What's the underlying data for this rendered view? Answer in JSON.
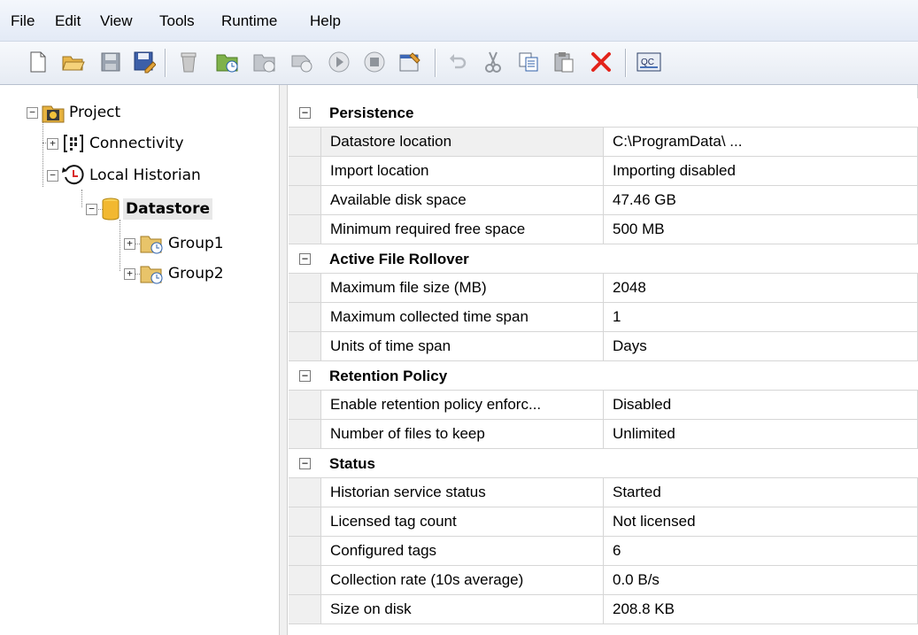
{
  "menu": [
    "File",
    "Edit",
    "View",
    "Tools",
    "Runtime",
    "Help"
  ],
  "toolbar": [
    {
      "name": "new-icon"
    },
    {
      "name": "open-folder-icon"
    },
    {
      "name": "save-icon"
    },
    {
      "name": "save-all-icon"
    },
    {
      "name": "delete-item-icon"
    },
    {
      "name": "add-group-icon"
    },
    {
      "name": "group-icon"
    },
    {
      "name": "tag-icon"
    },
    {
      "name": "start-icon"
    },
    {
      "name": "stop-icon"
    },
    {
      "name": "properties-icon"
    },
    {
      "name": "undo-icon"
    },
    {
      "name": "cut-icon"
    },
    {
      "name": "copy-icon"
    },
    {
      "name": "paste-icon"
    },
    {
      "name": "delete-icon"
    },
    {
      "name": "quick-client-icon",
      "text": "QC"
    }
  ],
  "tree": {
    "project": "Project",
    "connectivity": "Connectivity",
    "local_historian": "Local Historian",
    "datastore": "Datastore",
    "group1": "Group1",
    "group2": "Group2"
  },
  "grid": {
    "categories": [
      {
        "title": "Persistence",
        "props": [
          {
            "name": "Datastore location",
            "value": "C:\\ProgramData\\ ..."
          },
          {
            "name": "Import location",
            "value": "Importing disabled"
          },
          {
            "name": "Available disk space",
            "value": "47.46 GB"
          },
          {
            "name": "Minimum required free space",
            "value": "500 MB"
          }
        ]
      },
      {
        "title": "Active File Rollover",
        "props": [
          {
            "name": "Maximum file size (MB)",
            "value": "2048"
          },
          {
            "name": "Maximum collected time span",
            "value": "1"
          },
          {
            "name": "Units of time span",
            "value": "Days"
          }
        ]
      },
      {
        "title": "Retention Policy",
        "props": [
          {
            "name": "Enable retention policy enforc...",
            "value": "Disabled"
          },
          {
            "name": "Number of files to keep",
            "value": "Unlimited"
          }
        ]
      },
      {
        "title": "Status",
        "props": [
          {
            "name": "Historian service status",
            "value": "Started"
          },
          {
            "name": "Licensed tag count",
            "value": "Not licensed"
          },
          {
            "name": "Configured tags",
            "value": "6"
          },
          {
            "name": "Collection rate (10s average)",
            "value": "0.0 B/s"
          },
          {
            "name": "Size on disk",
            "value": "208.8 KB"
          }
        ]
      }
    ]
  }
}
